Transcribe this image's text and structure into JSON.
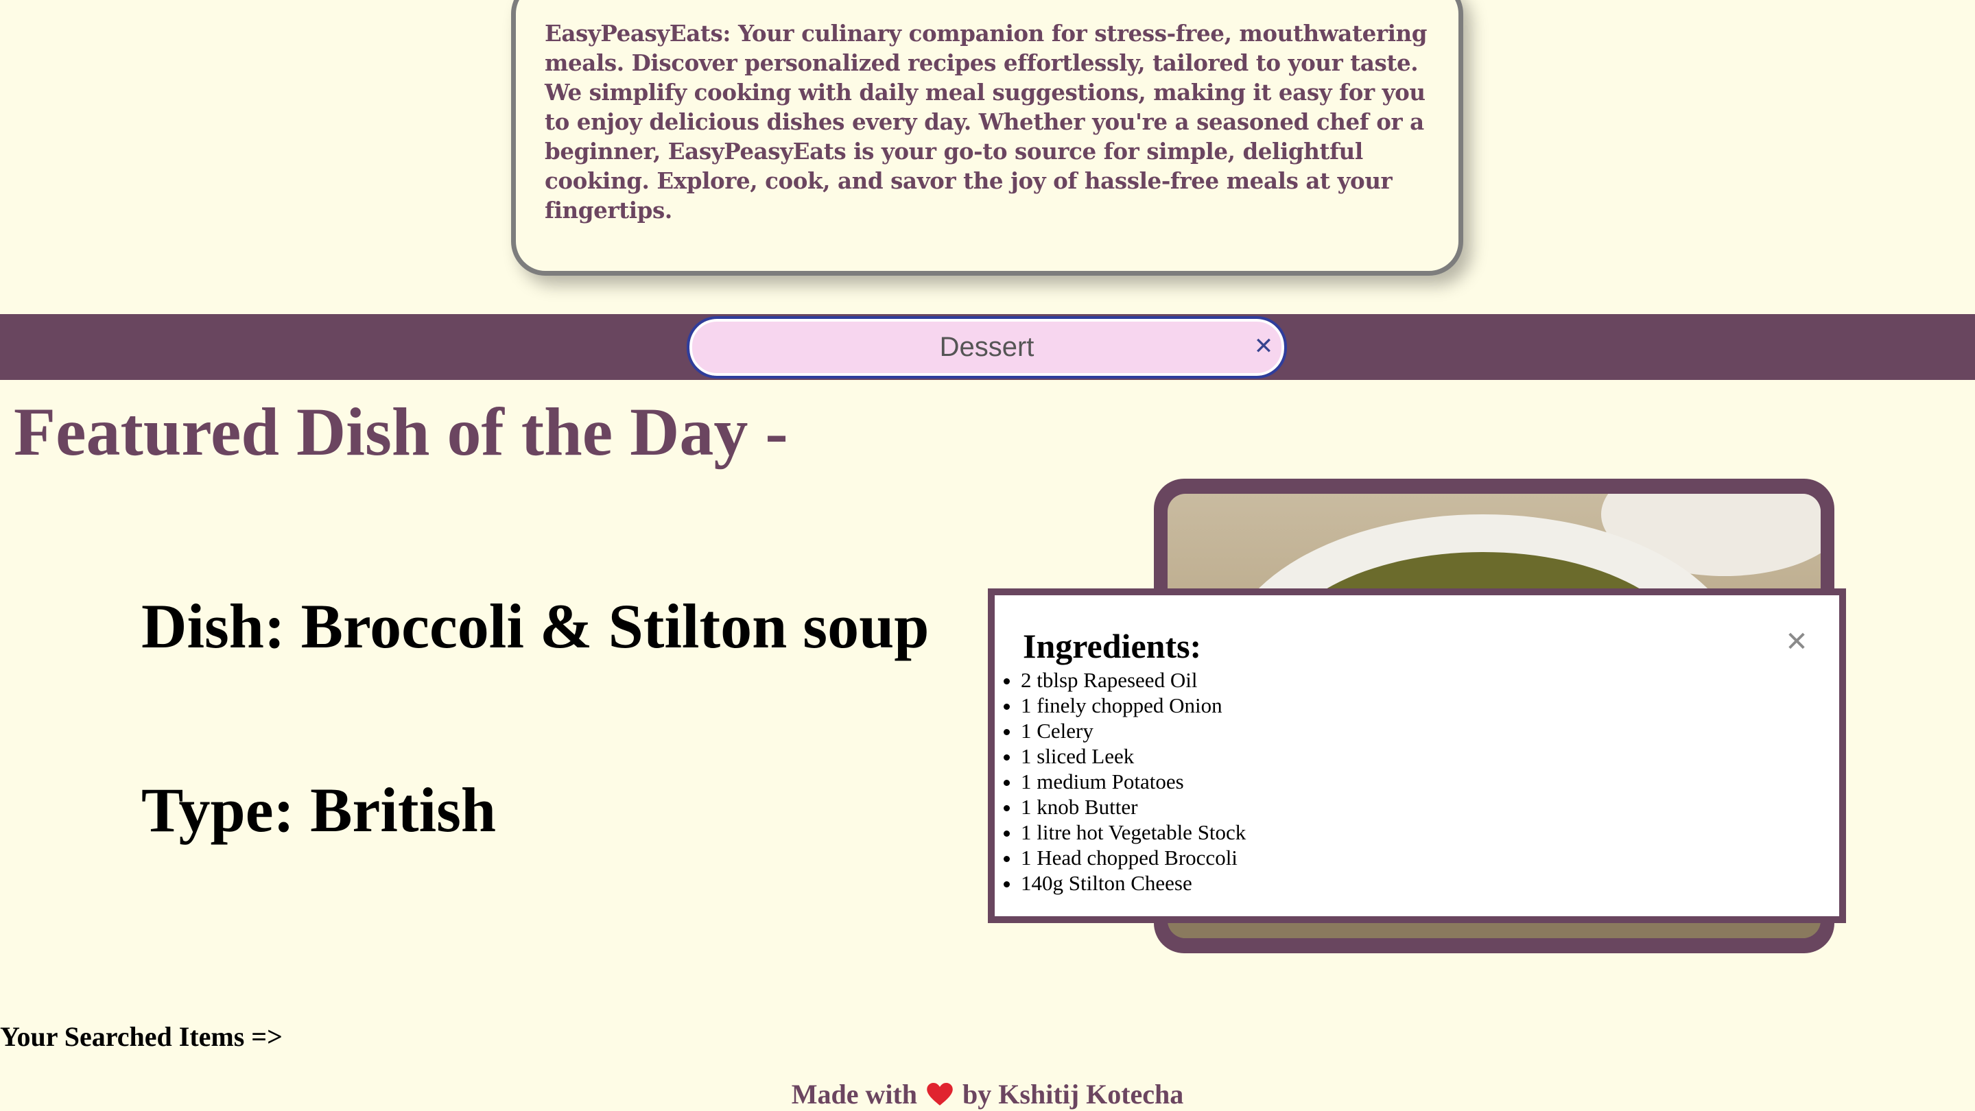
{
  "about": {
    "text": "EasyPeasyEats: Your culinary companion for stress-free, mouthwatering meals. Discover personalized recipes effortlessly, tailored to your taste. We simplify cooking with daily meal suggestions, making it easy for you to enjoy delicious dishes every day. Whether you're a seasoned chef or a beginner, EasyPeasyEats is your go-to source for simple, delightful cooking. Explore, cook, and savor the joy of hassle-free meals at your fingertips."
  },
  "search": {
    "value": "Dessert",
    "clear_icon": "close-icon"
  },
  "featured": {
    "title": "Featured Dish of the Day -",
    "dish": "Dish: Broccoli & Stilton soup",
    "type": "Type: British",
    "image_icon": "soup-bowl-photo"
  },
  "ingredients": {
    "heading": "Ingredients:",
    "items": [
      "2 tblsp Rapeseed Oil",
      "1 finely chopped Onion",
      "1 Celery",
      "1 sliced Leek",
      "1 medium Potatoes",
      "1 knob Butter",
      "1 litre hot Vegetable Stock",
      "1 Head chopped Broccoli",
      "140g Stilton Cheese"
    ],
    "close_icon": "close-icon"
  },
  "searched": {
    "label": "Your Searched Items =>"
  },
  "footer": {
    "made_with": "Made with",
    "by": "by Kshitij Kotecha"
  },
  "colors": {
    "background": "#fefce6",
    "brand": "#69465f",
    "search_fill": "#f7d6ef",
    "search_ring": "#2f3d9c",
    "heart": "#e0242f"
  }
}
